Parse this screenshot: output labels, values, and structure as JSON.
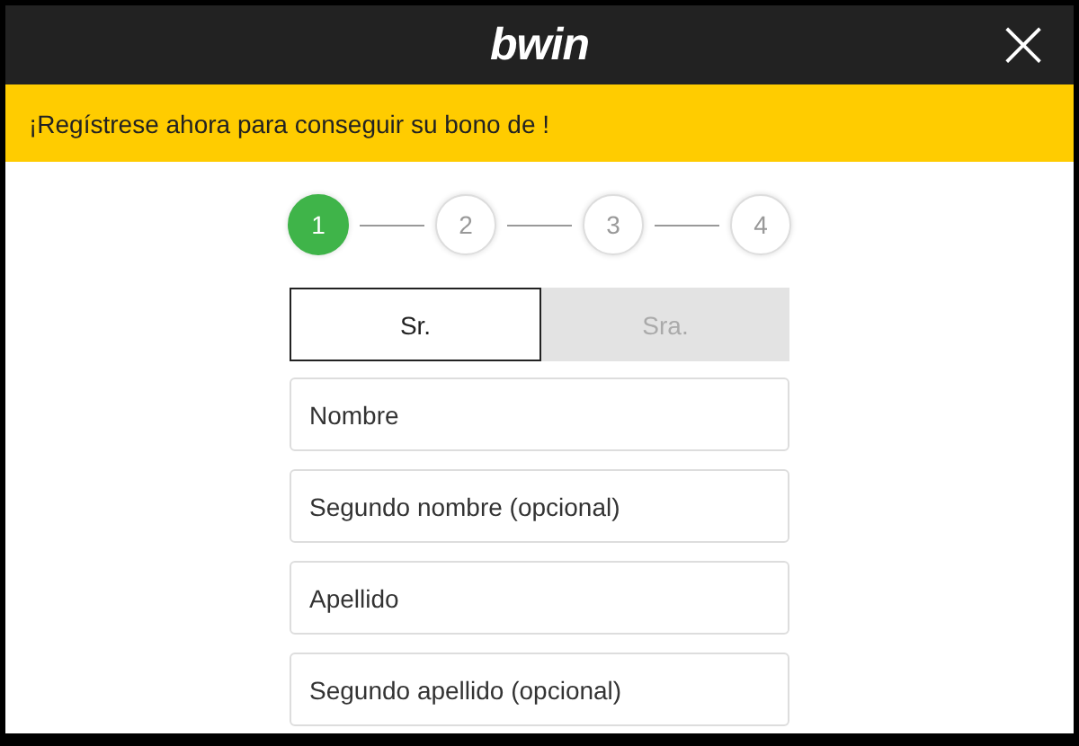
{
  "header": {
    "logo": "bwin",
    "close": "×"
  },
  "banner": {
    "text": "¡Regístrese ahora para conseguir su bono de !"
  },
  "steps": [
    {
      "label": "1",
      "selected": true
    },
    {
      "label": "2",
      "selected": false
    },
    {
      "label": "3",
      "selected": false
    },
    {
      "label": "4",
      "selected": false
    }
  ],
  "salutation": [
    {
      "label": "Sr.",
      "selected": true
    },
    {
      "label": "Sra.",
      "selected": false
    }
  ],
  "fields": [
    {
      "placeholder": "Nombre"
    },
    {
      "placeholder": "Segundo nombre (opcional)"
    },
    {
      "placeholder": "Apellido"
    },
    {
      "placeholder": "Segundo apellido (opcional)"
    }
  ]
}
